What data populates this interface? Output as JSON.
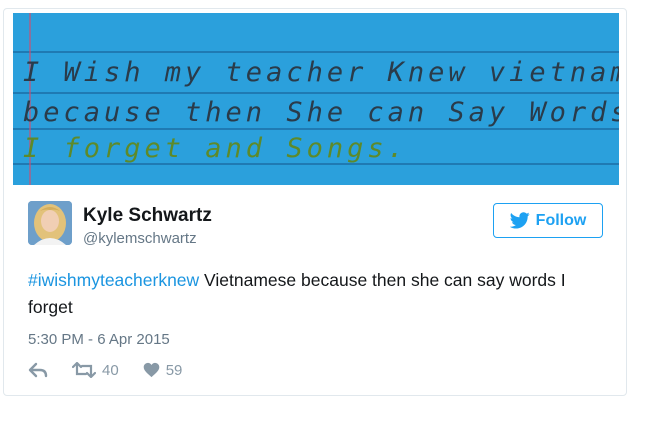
{
  "photo": {
    "handwriting_lines": [
      "I Wish my teacher Knew vietnamese",
      "because then She can Say Words that",
      "I forget and Songs."
    ]
  },
  "author": {
    "name": "Kyle Schwartz",
    "handle": "@kylemschwartz",
    "avatar_icon": "profile-photo"
  },
  "follow": {
    "label": "Follow",
    "icon": "twitter-bird-icon",
    "color": "#1da1f2"
  },
  "tweet": {
    "hashtag": "#iwishmyteacherknew",
    "text": " Vietnamese because then she can say words I forget",
    "timestamp": "5:30 PM - 6 Apr 2015"
  },
  "actions": {
    "reply_icon": "reply-icon",
    "retweet_icon": "retweet-icon",
    "retweet_count": "40",
    "like_icon": "heart-icon",
    "like_count": "59"
  },
  "colors": {
    "card_blue": "#2ba0dc",
    "link": "#1b95e0",
    "muted": "#657786"
  }
}
